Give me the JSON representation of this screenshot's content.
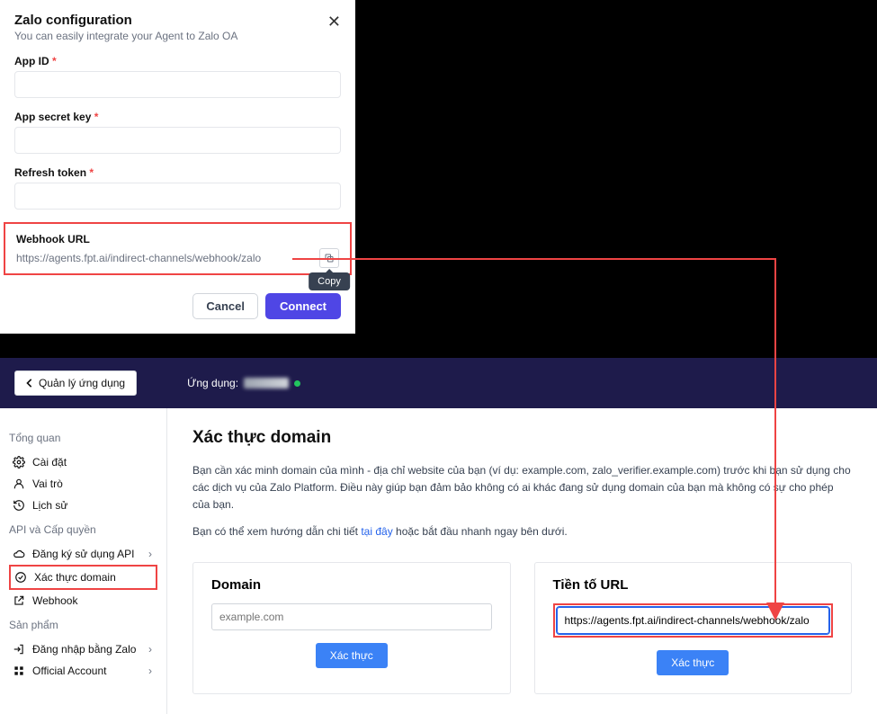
{
  "modal": {
    "title": "Zalo configuration",
    "subtitle": "You can easily integrate your Agent to Zalo OA",
    "fields": {
      "app_id": {
        "label": "App ID"
      },
      "app_secret": {
        "label": "App secret key"
      },
      "refresh_token": {
        "label": "Refresh token"
      }
    },
    "webhook": {
      "label": "Webhook URL",
      "url": "https://agents.fpt.ai/indirect-channels/webhook/zalo",
      "copy_tooltip": "Copy"
    },
    "actions": {
      "cancel": "Cancel",
      "connect": "Connect"
    }
  },
  "portal": {
    "topbar": {
      "manage_apps": "Quản lý ứng dụng",
      "app_label": "Ứng dụng:"
    },
    "sidebar": {
      "overview": "Tổng quan",
      "settings": "Cài đặt",
      "roles": "Vai trò",
      "history": "Lịch sử",
      "api_section": "API và Cấp quyền",
      "api_register": "Đăng ký sử dụng API",
      "verify_domain": "Xác thực domain",
      "webhook": "Webhook",
      "products_section": "Sản phẩm",
      "login_zalo": "Đăng nhập bằng Zalo",
      "official_account": "Official Account"
    },
    "main": {
      "title": "Xác thực domain",
      "desc1_a": "Bạn cần xác minh domain của mình - địa chỉ website của bạn (ví dụ: example.com, zalo_verifier.example.com) trước khi bạn sử dụng cho các dịch vụ của Zalo Platform. Điều này giúp bạn đảm bảo không có ai khác đang sử dụng domain của bạn mà không có sự cho phép của bạn.",
      "desc2_a": "Bạn có thể xem hướng dẫn chi tiết ",
      "desc2_link": "tại đây",
      "desc2_b": " hoặc bắt đầu nhanh ngay bên dưới.",
      "card_domain": {
        "title": "Domain",
        "placeholder": "example.com",
        "verify": "Xác thực"
      },
      "card_url": {
        "title": "Tiền tố URL",
        "value": "https://agents.fpt.ai/indirect-channels/webhook/zalo",
        "verify": "Xác thực"
      }
    }
  }
}
